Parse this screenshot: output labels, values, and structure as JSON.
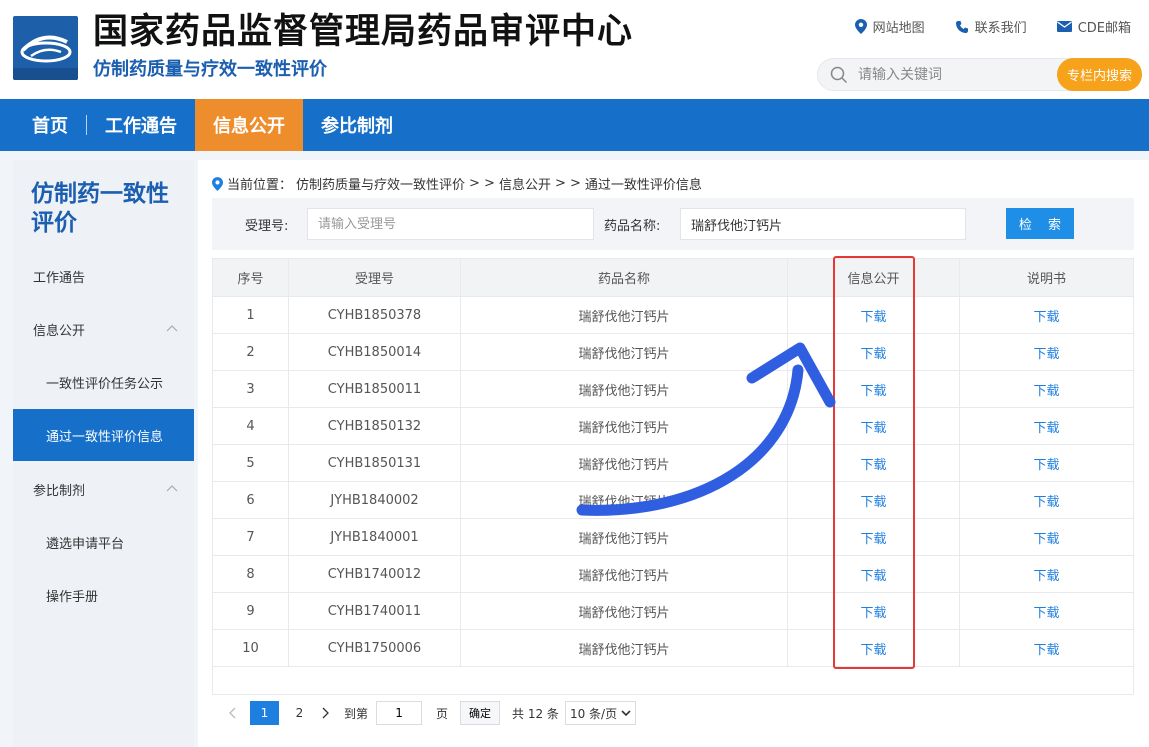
{
  "header": {
    "title": "国家药品监督管理局药品审评中心",
    "subtitle": "仿制药质量与疗效一致性评价",
    "links": [
      {
        "label": "网站地图",
        "icon": "location-pin-icon"
      },
      {
        "label": "联系我们",
        "icon": "phone-icon"
      },
      {
        "label": "CDE邮箱",
        "icon": "mail-icon"
      }
    ],
    "search_placeholder": "请输入关键词",
    "search_button": "专栏内搜索"
  },
  "nav": {
    "items": [
      {
        "label": "首页",
        "active": false
      },
      {
        "label": "工作通告",
        "active": false
      },
      {
        "label": "信息公开",
        "active": true
      },
      {
        "label": "参比制剂",
        "active": false
      }
    ]
  },
  "sidebar": {
    "title": "仿制药一致性评价",
    "items": [
      {
        "label": "工作通告",
        "level": 1
      },
      {
        "label": "信息公开",
        "level": 1,
        "expanded": true
      },
      {
        "label": "一致性评价任务公示",
        "level": 2
      },
      {
        "label": "通过一致性评价信息",
        "level": 2,
        "active": true
      },
      {
        "label": "参比制剂",
        "level": 1,
        "expanded": true
      },
      {
        "label": "遴选申请平台",
        "level": 2
      },
      {
        "label": "操作手册",
        "level": 2
      }
    ]
  },
  "breadcrumb": {
    "prefix": "当前位置：",
    "parts": [
      "仿制药质量与疗效一致性评价",
      "信息公开",
      "通过一致性评价信息"
    ],
    "separator": "> >"
  },
  "filter": {
    "accept_label": "受理号:",
    "accept_placeholder": "请输入受理号",
    "drug_label": "药品名称:",
    "drug_value": "瑞舒伐他汀钙片",
    "search_button": "检 索"
  },
  "table": {
    "columns": [
      "序号",
      "受理号",
      "药品名称",
      "信息公开",
      "说明书"
    ],
    "rows": [
      [
        "1",
        "CYHB1850378",
        "瑞舒伐他汀钙片",
        "下载",
        "下载"
      ],
      [
        "2",
        "CYHB1850014",
        "瑞舒伐他汀钙片",
        "下载",
        "下载"
      ],
      [
        "3",
        "CYHB1850011",
        "瑞舒伐他汀钙片",
        "下载",
        "下载"
      ],
      [
        "4",
        "CYHB1850132",
        "瑞舒伐他汀钙片",
        "下载",
        "下载"
      ],
      [
        "5",
        "CYHB1850131",
        "瑞舒伐他汀钙片",
        "下载",
        "下载"
      ],
      [
        "6",
        "JYHB1840002",
        "瑞舒伐他汀钙片",
        "下载",
        "下载"
      ],
      [
        "7",
        "JYHB1840001",
        "瑞舒伐他汀钙片",
        "下载",
        "下载"
      ],
      [
        "8",
        "CYHB1740012",
        "瑞舒伐他汀钙片",
        "下载",
        "下载"
      ],
      [
        "9",
        "CYHB1740011",
        "瑞舒伐他汀钙片",
        "下载",
        "下载"
      ],
      [
        "10",
        "CYHB1750006",
        "瑞舒伐他汀钙片",
        "下载",
        "下载"
      ]
    ]
  },
  "pagination": {
    "pages": [
      "1",
      "2"
    ],
    "current": "1",
    "goto_label": "到第",
    "goto_value": "1",
    "page_unit": "页",
    "confirm": "确定",
    "total": "共 12 条",
    "page_size": "10 条/页"
  },
  "annotations": {
    "highlight_color": "#e53935",
    "arrow_color": "#2f5fe0"
  },
  "colors": {
    "nav_blue": "#1670c9",
    "nav_active_orange": "#ee8d2c",
    "link_blue": "#1f7fe0",
    "search_orange": "#f7a21b"
  }
}
